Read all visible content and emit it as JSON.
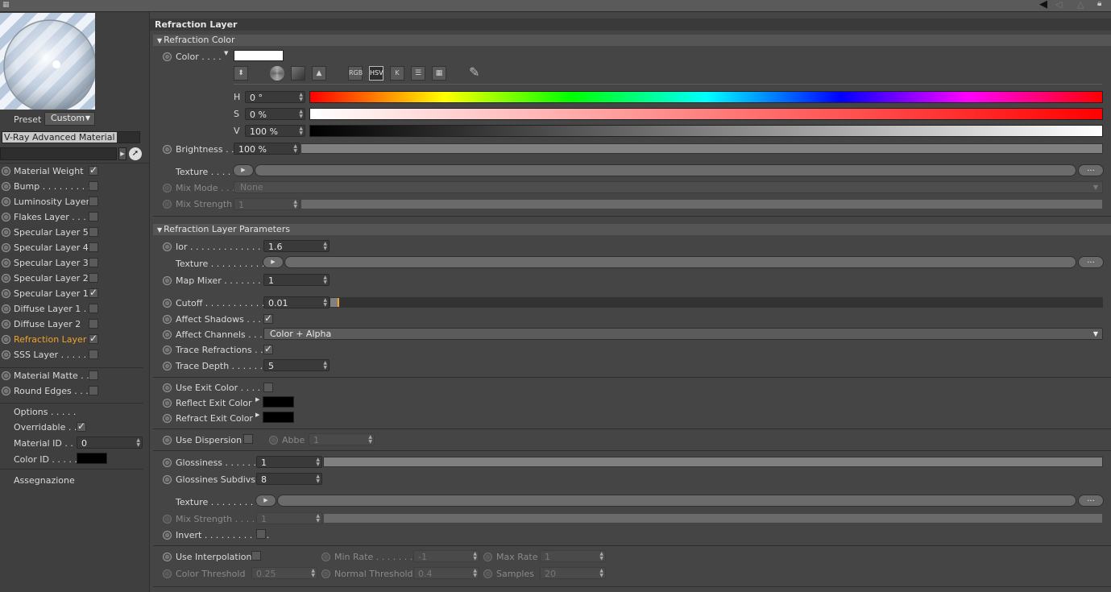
{
  "left": {
    "preset_label": "Preset",
    "preset_value": "Custom",
    "material_name": "V-Ray Advanced Material",
    "layers": [
      {
        "label": "Material Weight",
        "checked": true,
        "active": false
      },
      {
        "label": "Bump . . . . . . . . .",
        "checked": false,
        "active": false
      },
      {
        "label": "Luminosity Layer",
        "checked": false,
        "active": false
      },
      {
        "label": "Flakes Layer . . .",
        "checked": false,
        "active": false
      },
      {
        "label": "Specular Layer 5",
        "checked": false,
        "active": false
      },
      {
        "label": "Specular Layer 4",
        "checked": false,
        "active": false
      },
      {
        "label": "Specular Layer 3",
        "checked": false,
        "active": false
      },
      {
        "label": "Specular Layer 2",
        "checked": false,
        "active": false
      },
      {
        "label": "Specular Layer 1",
        "checked": true,
        "active": false
      },
      {
        "label": "Diffuse Layer 1 .",
        "checked": false,
        "active": false
      },
      {
        "label": "Diffuse Layer 2",
        "checked": false,
        "active": false
      },
      {
        "label": "Refraction Layer",
        "checked": true,
        "active": true
      },
      {
        "label": "SSS Layer . . . . .",
        "checked": false,
        "active": false
      }
    ],
    "extra_layers": [
      {
        "label": "Material Matte . .",
        "checked": false
      },
      {
        "label": "Round Edges . . .",
        "checked": false
      }
    ],
    "options_label": "Options . . . . .",
    "overridable_label": "Overridable . .",
    "material_id_label": "Material ID . . .",
    "material_id_value": "0",
    "color_id_label": "Color ID . . . . .",
    "assegnazione_label": "Assegnazione"
  },
  "panel_title": "Refraction Layer",
  "refraction_color": {
    "header": "Refraction Color",
    "color_label": "Color . . . .",
    "mode_buttons": [
      "RGB",
      "HSV",
      "K"
    ],
    "h_label": "H",
    "h_value": "0 °",
    "s_label": "S",
    "s_value": "0 %",
    "v_label": "V",
    "v_value": "100 %",
    "brightness_label": "Brightness . .",
    "brightness_value": "100 %",
    "texture_label": "Texture . . . . .",
    "mix_mode_label": "Mix Mode . . .",
    "mix_mode_value": "None",
    "mix_strength_label": "Mix Strength",
    "mix_strength_value": "1",
    "more_button": "..."
  },
  "params": {
    "header": "Refraction Layer Parameters",
    "ior_label": "Ior . . . . . . . . . . . . . . .",
    "ior_value": "1.6",
    "texture_label": "Texture . . . . . . . . . . .",
    "map_mixer_label": "Map Mixer . . . . . . . .",
    "map_mixer_value": "1",
    "cutoff_label": "Cutoff . . . . . . . . . . . .",
    "cutoff_value": "0.01",
    "affect_shadows_label": "Affect Shadows . . .",
    "affect_channels_label": "Affect Channels . . .",
    "affect_channels_value": "Color + Alpha",
    "trace_refractions_label": "Trace Refractions . .",
    "trace_depth_label": "Trace Depth . . . . . .",
    "trace_depth_value": "5",
    "use_exit_color_label": "Use Exit Color . . . . .",
    "reflect_exit_label": "Reflect Exit Color",
    "refract_exit_label": "Refract Exit Color",
    "use_dispersion_label": "Use Dispersion",
    "abbe_label": "Abbe",
    "abbe_value": "1",
    "glossiness_label": "Glossiness . . . . . . .",
    "glossiness_value": "1",
    "gloss_subdivs_label": "Glossines Subdivs",
    "gloss_subdivs_value": "8",
    "texture2_label": "Texture . . . . . . . . . . .",
    "mix_strength_label": "Mix Strength . . . . .",
    "mix_strength_value": "1",
    "invert_label": "Invert . . . . . . . . . . . .",
    "use_interp_label": "Use Interpolation",
    "min_rate_label": "Min Rate . . . . . . .",
    "min_rate_value": "-1",
    "max_rate_label": "Max Rate",
    "max_rate_value": "1",
    "color_threshold_label": "Color Threshold",
    "color_threshold_value": "0.25",
    "normal_threshold_label": "Normal Threshold",
    "normal_threshold_value": "0.4",
    "samples_label": "Samples",
    "samples_value": "20"
  }
}
